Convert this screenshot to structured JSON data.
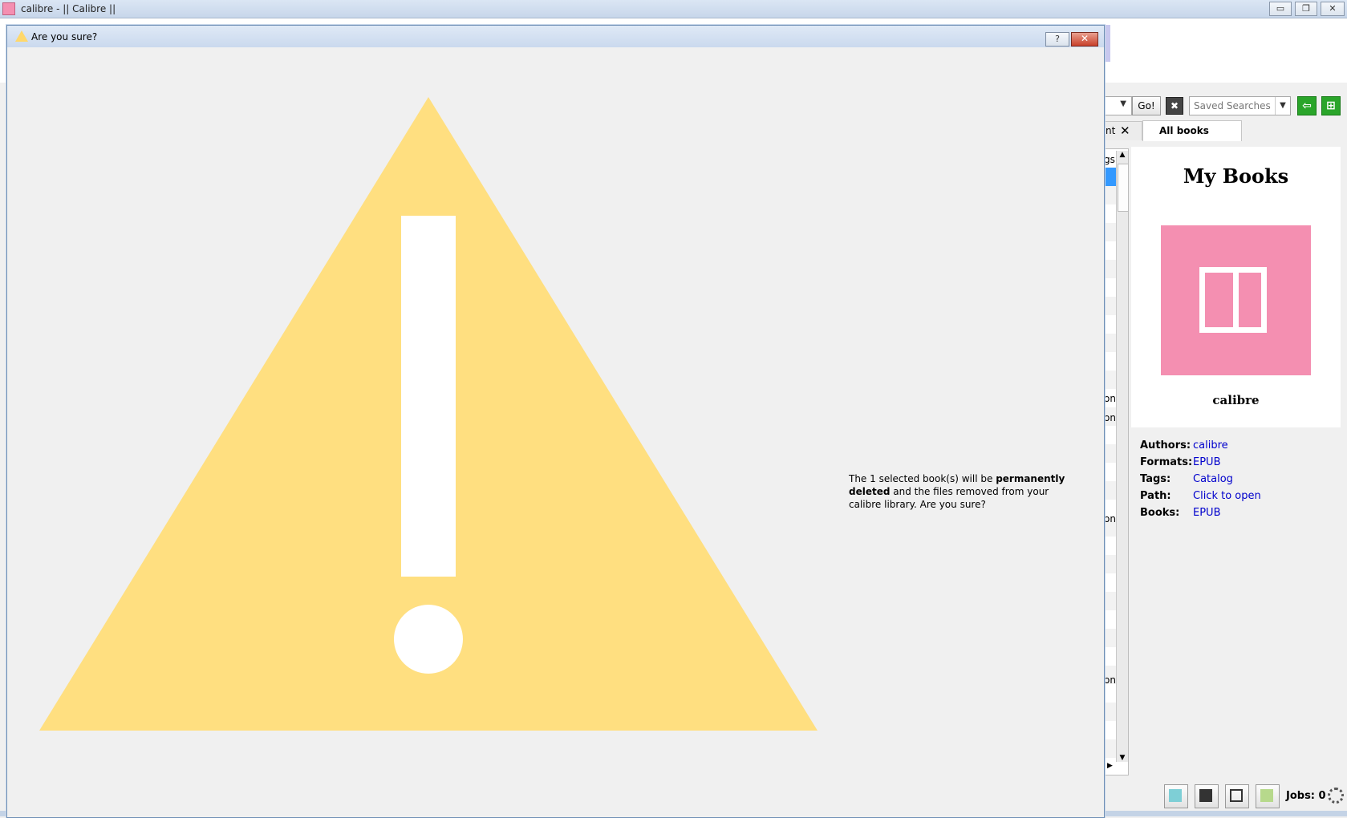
{
  "window": {
    "title": "calibre - || Calibre ||",
    "minimize_glyph": "▭",
    "restore_glyph": "❐",
    "close_glyph": "✕"
  },
  "toolbar": {
    "go_label": "Go!",
    "clear_glyph": "✖",
    "saved_searches_placeholder": "Saved Searches",
    "dropdown_glyph": "▼"
  },
  "tabs": {
    "partial_label": "nt",
    "partial_close": "✕",
    "all_books": "All books"
  },
  "book_list": {
    "fragments": [
      "gs",
      "on",
      "on",
      "on",
      "on"
    ]
  },
  "book_details": {
    "cover_title": "My Books",
    "cover_author": "calibre",
    "fields": [
      {
        "key": "Authors:",
        "value": "calibre"
      },
      {
        "key": "Formats:",
        "value": "EPUB"
      },
      {
        "key": "Tags:",
        "value": "Catalog"
      },
      {
        "key": "Path:",
        "value": "Click to open"
      },
      {
        "key": "Books:",
        "value": "EPUB"
      }
    ]
  },
  "status": {
    "jobs": "Jobs: 0"
  },
  "dialog": {
    "title": "Are you sure?",
    "help_glyph": "?",
    "close_glyph": "✕",
    "message_part1": "The 1 selected book(s) will be ",
    "message_bold": "permanently deleted",
    "message_part2": " and the files removed from your calibre library. Are you sure?",
    "warning_color": "#ffdf80"
  },
  "colors": {
    "cover_pink": "#f48fb1",
    "link_blue": "#0000cc",
    "selection_blue": "#3399ff"
  }
}
